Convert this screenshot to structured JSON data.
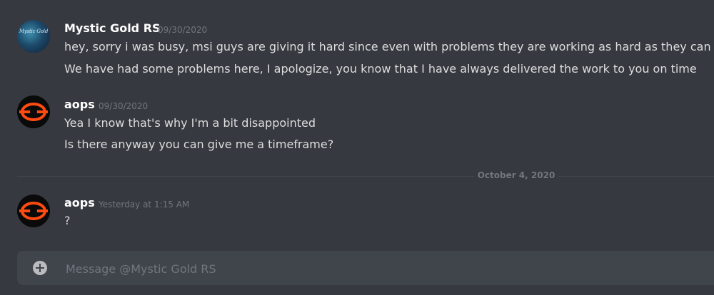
{
  "messages": [
    {
      "author": "Mystic Gold RS",
      "timestamp": "09/30/2020",
      "avatar_icon": "mystic-gold-logo-icon",
      "avatar_text": "Mystic Gold",
      "lines": [
        "hey, sorry i was busy, msi guys are giving it hard since even with problems they are working as hard as they can",
        "We have had some problems here, I apologize, you know that I have always delivered the work to you on time"
      ]
    },
    {
      "author": "aops",
      "timestamp": "09/30/2020",
      "avatar_icon": "aops-logo-icon",
      "lines": [
        "Yea I know that's why I'm a bit disappointed",
        "Is there anyway you can give me a timeframe?"
      ]
    },
    {
      "author": "aops",
      "timestamp": "Yesterday at 1:15 AM",
      "avatar_icon": "aops-logo-icon",
      "lines": [
        "?"
      ]
    }
  ],
  "date_divider": "October 4, 2020",
  "composer": {
    "placeholder": "Message @Mystic Gold RS",
    "add_icon": "plus-circle-icon"
  },
  "colors": {
    "background": "#36393f",
    "composer_bg": "#40444b",
    "text": "#dcddde",
    "muted": "#72767d",
    "accent_orange": "#ff4a10"
  }
}
